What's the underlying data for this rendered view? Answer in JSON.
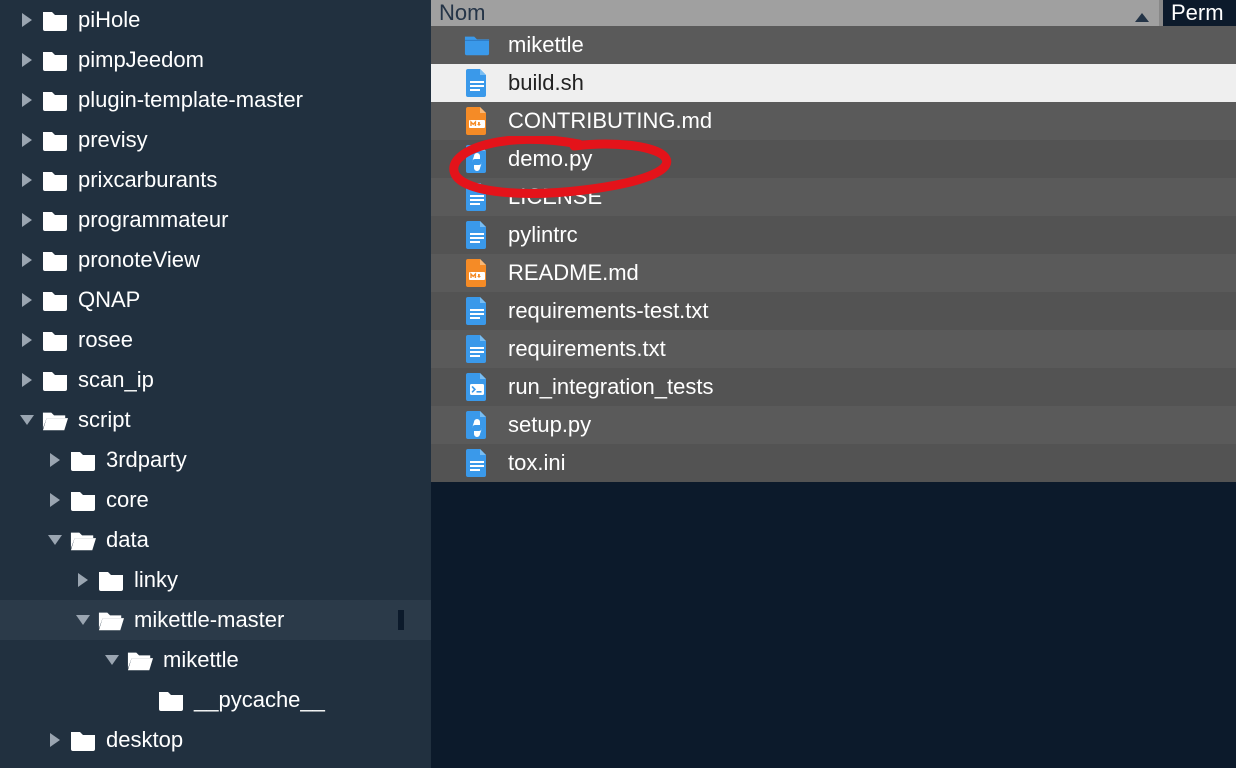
{
  "tree": {
    "items": [
      {
        "label": "piHole",
        "indent": 1,
        "arrow": "right",
        "open": false
      },
      {
        "label": "pimpJeedom",
        "indent": 1,
        "arrow": "right",
        "open": false
      },
      {
        "label": "plugin-template-master",
        "indent": 1,
        "arrow": "right",
        "open": false
      },
      {
        "label": "previsy",
        "indent": 1,
        "arrow": "right",
        "open": false
      },
      {
        "label": "prixcarburants",
        "indent": 1,
        "arrow": "right",
        "open": false
      },
      {
        "label": "programmateur",
        "indent": 1,
        "arrow": "right",
        "open": false
      },
      {
        "label": "pronoteView",
        "indent": 1,
        "arrow": "right",
        "open": false
      },
      {
        "label": "QNAP",
        "indent": 1,
        "arrow": "right",
        "open": false
      },
      {
        "label": "rosee",
        "indent": 1,
        "arrow": "right",
        "open": false
      },
      {
        "label": "scan_ip",
        "indent": 1,
        "arrow": "right",
        "open": false
      },
      {
        "label": "script",
        "indent": 1,
        "arrow": "down",
        "open": true
      },
      {
        "label": "3rdparty",
        "indent": 2,
        "arrow": "right",
        "open": false
      },
      {
        "label": "core",
        "indent": 2,
        "arrow": "right",
        "open": false
      },
      {
        "label": "data",
        "indent": 2,
        "arrow": "down",
        "open": true
      },
      {
        "label": "linky",
        "indent": 3,
        "arrow": "right",
        "open": false
      },
      {
        "label": "mikettle-master",
        "indent": 3,
        "arrow": "down",
        "open": true,
        "selected": true
      },
      {
        "label": "mikettle",
        "indent": 4,
        "arrow": "down",
        "open": true
      },
      {
        "label": "__pycache__",
        "indent": 5,
        "arrow": "none",
        "open": false
      },
      {
        "label": "desktop",
        "indent": 2,
        "arrow": "right",
        "open": false
      }
    ]
  },
  "columns": {
    "name": "Nom",
    "perm": "Perm"
  },
  "files": {
    "items": [
      {
        "label": "mikettle",
        "icon": "folder",
        "alt": true
      },
      {
        "label": "build.sh",
        "icon": "doc",
        "alt": false,
        "selected": true
      },
      {
        "label": "CONTRIBUTING.md",
        "icon": "md",
        "alt": true
      },
      {
        "label": "demo.py",
        "icon": "py",
        "alt": false,
        "annot": true
      },
      {
        "label": "LICENSE",
        "icon": "doc",
        "alt": true
      },
      {
        "label": "pylintrc",
        "icon": "doc",
        "alt": false
      },
      {
        "label": "README.md",
        "icon": "md",
        "alt": true
      },
      {
        "label": "requirements-test.txt",
        "icon": "doc",
        "alt": false
      },
      {
        "label": "requirements.txt",
        "icon": "doc",
        "alt": true
      },
      {
        "label": "run_integration_tests",
        "icon": "script",
        "alt": false
      },
      {
        "label": "setup.py",
        "icon": "py",
        "alt": true
      },
      {
        "label": "tox.ini",
        "icon": "doc",
        "alt": false
      }
    ]
  },
  "colors": {
    "doc": "#3a99ea",
    "md": "#f58b26",
    "py": "#3a99ea",
    "script": "#3a99ea",
    "folder": "#3a99ea"
  }
}
